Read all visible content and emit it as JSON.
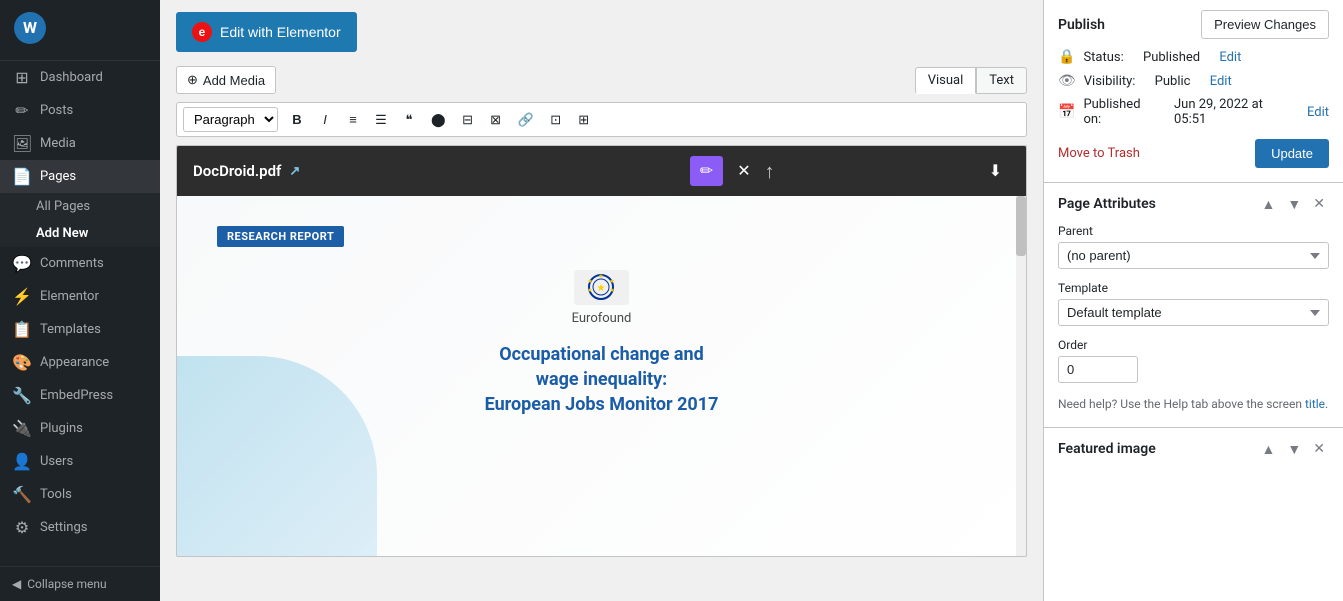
{
  "sidebar": {
    "items": [
      {
        "id": "dashboard",
        "label": "Dashboard",
        "icon": "⊞"
      },
      {
        "id": "posts",
        "label": "Posts",
        "icon": "📝"
      },
      {
        "id": "media",
        "label": "Media",
        "icon": "🖼"
      },
      {
        "id": "pages",
        "label": "Pages",
        "icon": "📄",
        "active": true
      },
      {
        "id": "comments",
        "label": "Comments",
        "icon": "💬"
      },
      {
        "id": "elementor",
        "label": "Elementor",
        "icon": "⚡"
      },
      {
        "id": "templates",
        "label": "Templates",
        "icon": "📋"
      },
      {
        "id": "appearance",
        "label": "Appearance",
        "icon": "🎨"
      },
      {
        "id": "embedpress",
        "label": "EmbedPress",
        "icon": "🔧"
      },
      {
        "id": "plugins",
        "label": "Plugins",
        "icon": "🔌"
      },
      {
        "id": "users",
        "label": "Users",
        "icon": "👤"
      },
      {
        "id": "tools",
        "label": "Tools",
        "icon": "🔨"
      },
      {
        "id": "settings",
        "label": "Settings",
        "icon": "⚙"
      }
    ],
    "pages_subitems": [
      {
        "id": "all-pages",
        "label": "All Pages",
        "active": false
      },
      {
        "id": "add-new",
        "label": "Add New",
        "active": true
      }
    ],
    "collapse_label": "Collapse menu"
  },
  "toolbar": {
    "edit_elementor_label": "Edit with Elementor",
    "add_media_label": "Add Media",
    "visual_tab": "Visual",
    "text_tab": "Text",
    "paragraph_label": "Paragraph",
    "format_buttons": [
      "B",
      "I",
      "≡",
      "☰",
      "❝",
      "⬡",
      "⬡",
      "⬡",
      "🔗",
      "⬡",
      "⬡"
    ]
  },
  "pdf": {
    "filename": "DocDroid.pdf",
    "badge_text": "RESEARCH REPORT",
    "logo_text": "Eurofound",
    "title_line1": "Occupational change and",
    "title_line2": "wage inequality:",
    "title_line3": "European Jobs Monitor 2017"
  },
  "publish": {
    "section_title": "Publish",
    "preview_changes_label": "Preview Changes",
    "status_label": "Status:",
    "status_value": "Published",
    "status_edit": "Edit",
    "visibility_label": "Visibility:",
    "visibility_value": "Public",
    "visibility_edit": "Edit",
    "published_label": "Published on:",
    "published_value": "Jun 29, 2022 at 05:51",
    "published_edit": "Edit",
    "move_to_trash": "Move to Trash",
    "update_label": "Update"
  },
  "page_attributes": {
    "section_title": "Page Attributes",
    "parent_label": "Parent",
    "parent_value": "(no parent)",
    "template_label": "Template",
    "template_value": "Default template",
    "order_label": "Order",
    "order_value": "0",
    "help_text": "Need help? Use the Help tab above the screen title."
  },
  "featured_image": {
    "section_title": "Featured image"
  }
}
